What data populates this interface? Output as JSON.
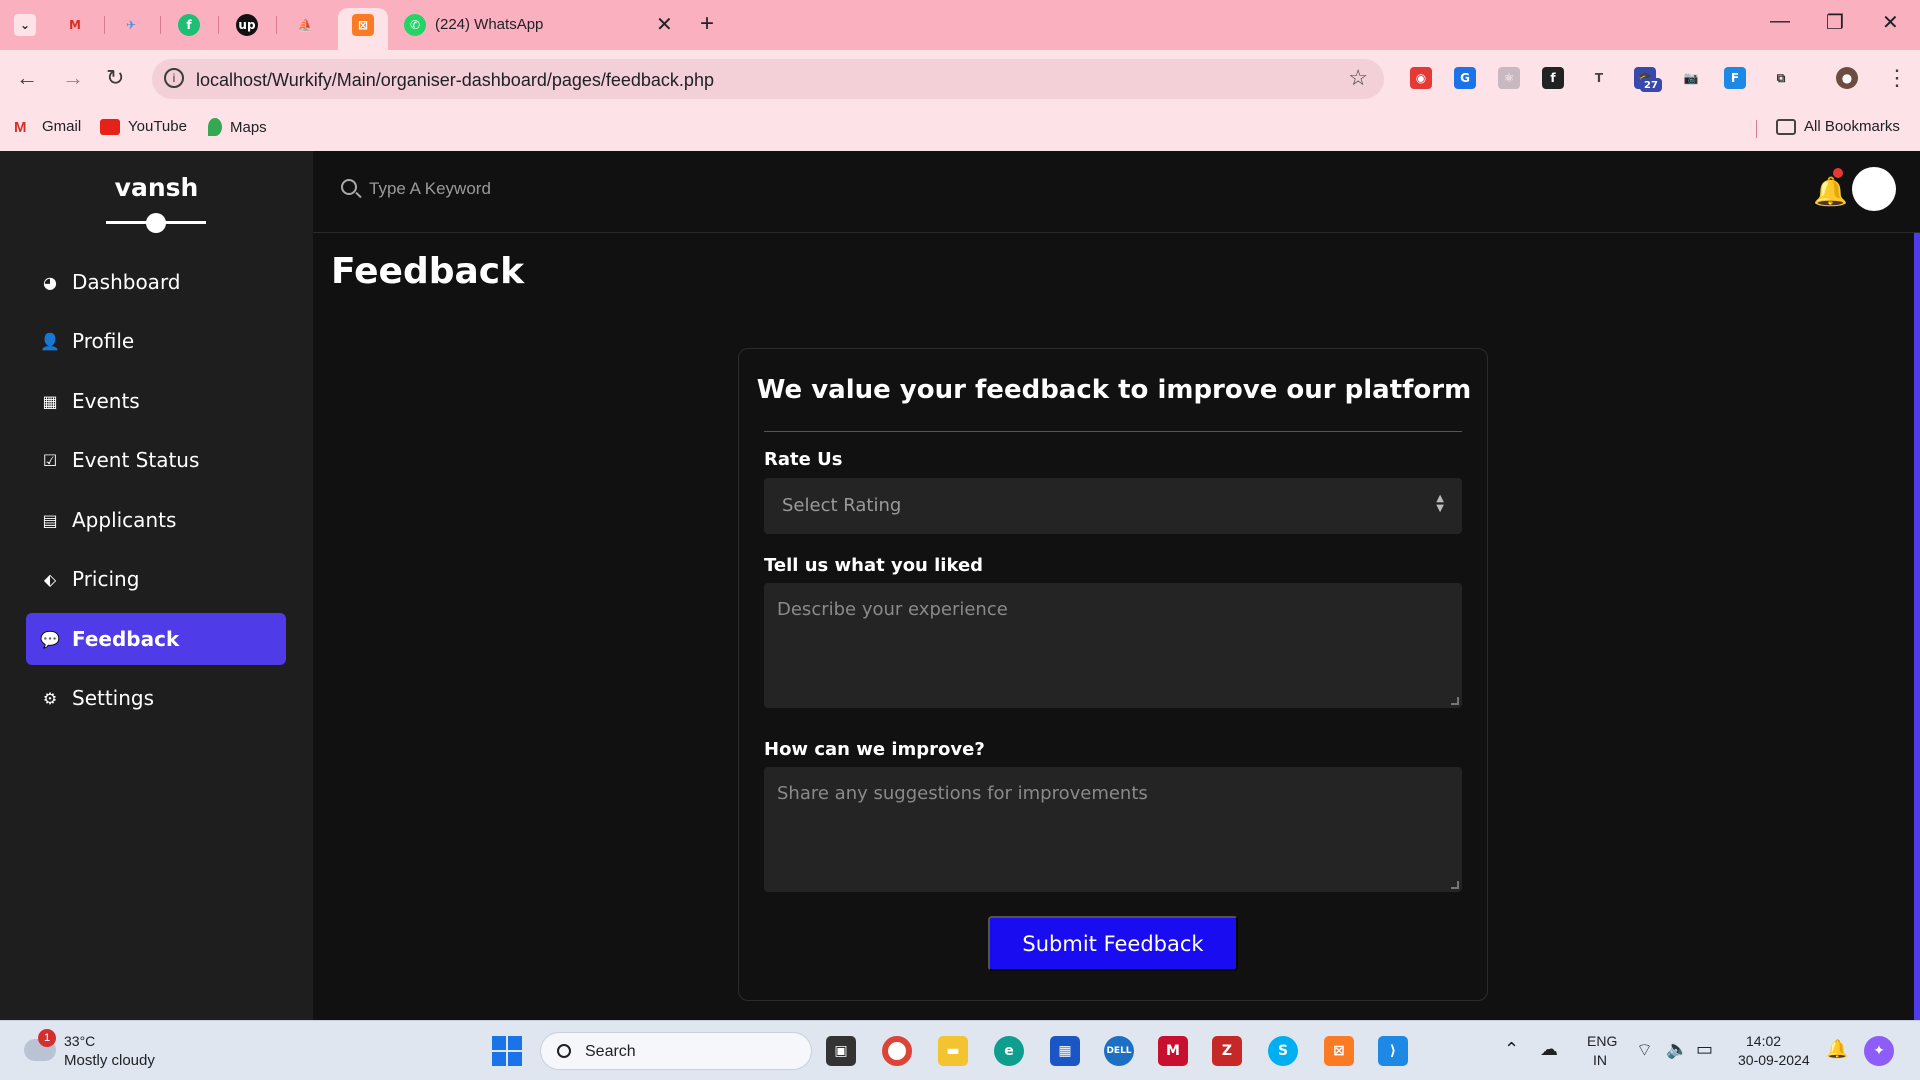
{
  "browser": {
    "tabs": [
      {
        "label": "(224) WhatsApp"
      }
    ],
    "url": "localhost/Wurkify/Main/organiser-dashboard/pages/feedback.php",
    "bookmarks": [
      {
        "label": "Gmail"
      },
      {
        "label": "YouTube"
      },
      {
        "label": "Maps"
      }
    ],
    "all_bookmarks_label": "All Bookmarks",
    "extension_badge": "27"
  },
  "sidebar": {
    "brand": "vansh",
    "items": [
      {
        "label": "Dashboard",
        "icon": "palette-icon"
      },
      {
        "label": "Profile",
        "icon": "user-icon"
      },
      {
        "label": "Events",
        "icon": "calendar-icon"
      },
      {
        "label": "Event Status",
        "icon": "calendar-check-icon"
      },
      {
        "label": "Applicants",
        "icon": "card-icon"
      },
      {
        "label": "Pricing",
        "icon": "tag-icon"
      },
      {
        "label": "Feedback",
        "icon": "comment-icon",
        "active": true
      },
      {
        "label": "Settings",
        "icon": "gear-icon"
      }
    ]
  },
  "topbar": {
    "search_placeholder": "Type A Keyword"
  },
  "main": {
    "page_title": "Feedback",
    "card": {
      "title": "We value your feedback to improve our platform",
      "rate_label": "Rate Us",
      "rate_placeholder": "Select Rating",
      "liked_label": "Tell us what you liked",
      "liked_placeholder": "Describe your experience",
      "improve_label": "How can we improve?",
      "improve_placeholder": "Share any suggestions for improvements",
      "submit_label": "Submit Feedback"
    }
  },
  "taskbar": {
    "weather_temp": "33°C",
    "weather_desc": "Mostly cloudy",
    "weather_badge": "1",
    "search_label": "Search",
    "lang_1": "ENG",
    "lang_2": "IN",
    "time": "14:02",
    "date": "30-09-2024"
  },
  "colors": {
    "accent": "#4f3ce8",
    "submit": "#1a0cf0",
    "tab_bar": "#fbb0c0"
  }
}
